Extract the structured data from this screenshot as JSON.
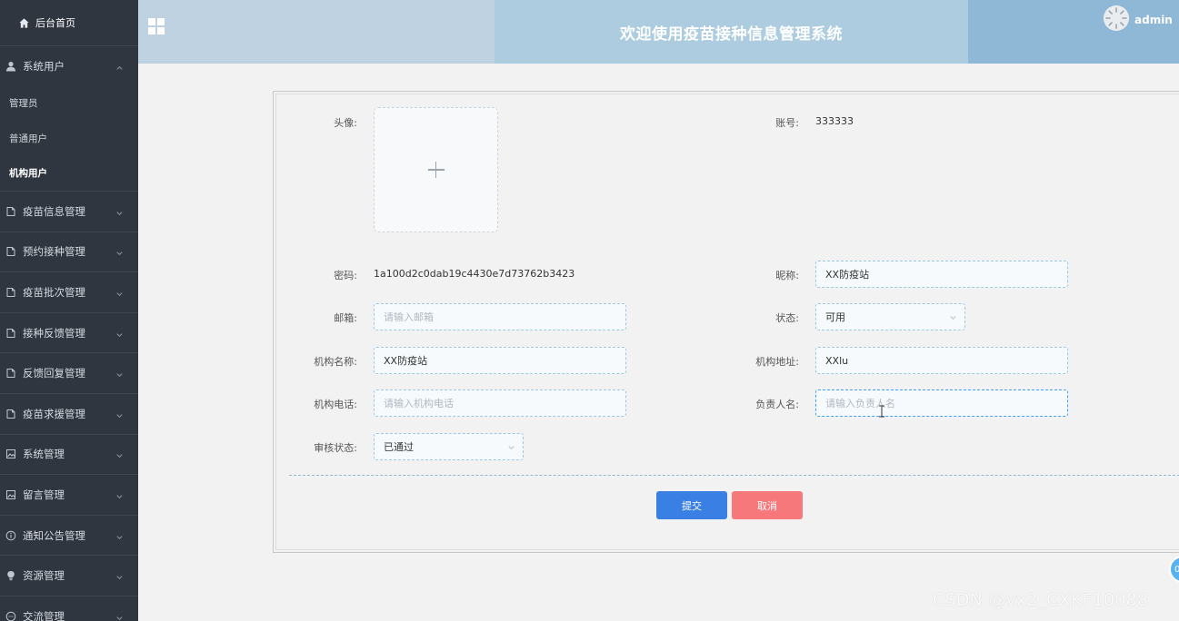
{
  "sidebar": {
    "home_label": "后台首页",
    "system_users": {
      "label": "系统用户",
      "children": [
        "管理员",
        "普通用户",
        "机构用户"
      ]
    },
    "groups": [
      {
        "label": "疫苗信息管理",
        "icon": "document-icon"
      },
      {
        "label": "预约接种管理",
        "icon": "document-icon"
      },
      {
        "label": "疫苗批次管理",
        "icon": "document-icon"
      },
      {
        "label": "接种反馈管理",
        "icon": "document-icon"
      },
      {
        "label": "反馈回复管理",
        "icon": "document-icon"
      },
      {
        "label": "疫苗求援管理",
        "icon": "document-icon"
      },
      {
        "label": "系统管理",
        "icon": "picture-icon"
      },
      {
        "label": "留言管理",
        "icon": "picture-icon"
      },
      {
        "label": "通知公告管理",
        "icon": "info-icon"
      },
      {
        "label": "资源管理",
        "icon": "bulb-icon"
      },
      {
        "label": "交流管理",
        "icon": "chat-icon"
      }
    ]
  },
  "header": {
    "title": "欢迎使用疫苗接种信息管理系统",
    "username": "admin"
  },
  "form": {
    "avatar_label": "头像:",
    "account_label": "账号:",
    "account_value": "333333",
    "password_label": "密码:",
    "password_value": "1a100d2c0dab19c4430e7d73762b3423",
    "nickname_label": "昵称:",
    "nickname_value": "XX防疫站",
    "email_label": "邮箱:",
    "email_placeholder": "请输入邮箱",
    "status_label": "状态:",
    "status_value": "可用",
    "org_name_label": "机构名称:",
    "org_name_value": "XX防疫站",
    "org_address_label": "机构地址:",
    "org_address_value": "XXlu",
    "org_phone_label": "机构电话:",
    "org_phone_placeholder": "请输入机构电话",
    "manager_label": "负责人名:",
    "manager_placeholder": "请输入负责人名",
    "review_label": "审核状态:",
    "review_value": "已通过",
    "submit_label": "提交",
    "cancel_label": "取消"
  },
  "watermark": "CSDN @vx2_CXKF10088",
  "float_button": "0",
  "colors": {
    "sidebar_bg": "#2f3640",
    "header_left": "#bfd2e1",
    "header_mid": "#adcce0",
    "header_right": "#8fb7d6",
    "submit": "#3a7fe3",
    "cancel": "#f7787b"
  }
}
